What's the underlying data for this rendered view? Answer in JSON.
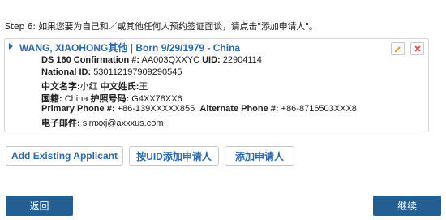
{
  "instruction": "Step 6: 如果您要为自己和／或其他任何人预约签证面谈，请点击\"添加申请人\"。",
  "applicant": {
    "name_line": "WANG, XIAOHONG其他 | Born 9/29/1979 - China",
    "ds160_label": "DS 160 Confirmation #:",
    "ds160_value": "AA003QXXYC",
    "uid_label": "UID:",
    "uid_value": "22904114",
    "national_id_label": "National ID:",
    "national_id_value": "530112197909290545",
    "given_name_label": "中文名字:",
    "given_name_value": "小红",
    "surname_label": "中文姓氏:",
    "surname_value": "王",
    "nationality_label": "国籍:",
    "nationality_value": "China",
    "passport_label": "护照号码:",
    "passport_value": "G4XX78XX6",
    "primary_phone_label": "Primary Phone #:",
    "primary_phone_value": "+86-139XXXXX855",
    "alt_phone_label": "Alternate Phone #:",
    "alt_phone_value": "+86-8716503XXX8",
    "email_label": "电子邮件:",
    "email_value": "simxxj@axxxus.com"
  },
  "icons": {
    "edit": "pencil-icon",
    "delete": "close-icon",
    "expand": "caret-right-icon"
  },
  "buttons": {
    "add_existing": "Add Existing Applicant",
    "add_by_uid": "按UID添加申请人",
    "add_applicant": "添加申请人",
    "back": "返回",
    "continue": "继续"
  },
  "colors": {
    "link_blue": "#2e6aa8",
    "primary_button": "#245f93",
    "edit_icon": "#e8a317",
    "delete_icon": "#d9534f"
  }
}
